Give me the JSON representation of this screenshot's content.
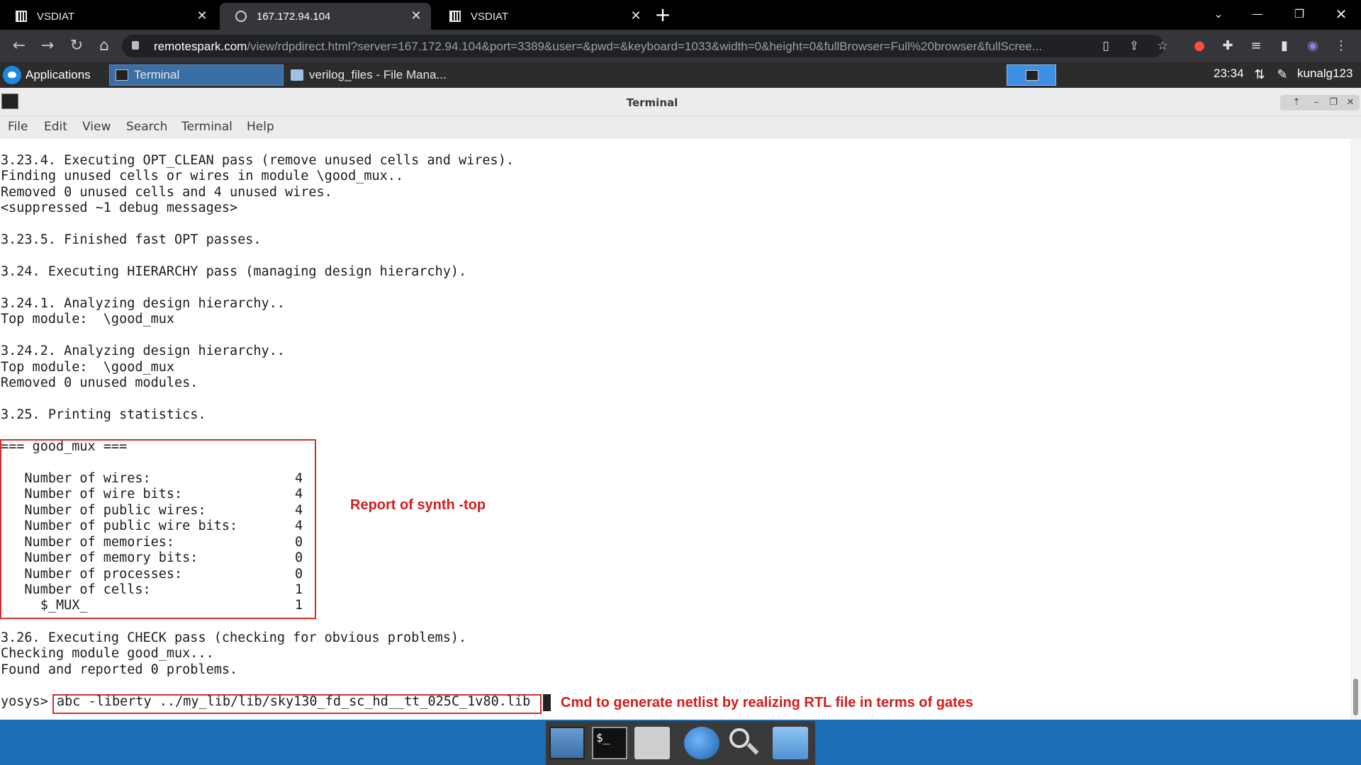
{
  "browser": {
    "tabs": [
      {
        "label": "VSDIAT",
        "icon": "chip-icon",
        "active": false
      },
      {
        "label": "167.172.94.104",
        "icon": "globe-icon",
        "active": true
      },
      {
        "label": "VSDIAT",
        "icon": "chip-icon",
        "active": false
      }
    ],
    "new_tab": "+",
    "url_host": "remotespark.com",
    "url_rest": "/view/rdpdirect.html?server=167.172.94.104&port=3389&user=&pwd=&keyboard=1033&width=0&height=0&fullBrowser=Full%20browser&fullScree..."
  },
  "panel": {
    "applications_label": "Applications",
    "tasks": [
      {
        "label": "Terminal",
        "active": true
      },
      {
        "label": "verilog_files - File Mana...",
        "active": false
      }
    ],
    "clock": "23:34",
    "user": "kunalg123"
  },
  "window": {
    "title": "Terminal",
    "menu": [
      "File",
      "Edit",
      "View",
      "Search",
      "Terminal",
      "Help"
    ]
  },
  "terminal": {
    "lines": [
      "3.23.4. Executing OPT_CLEAN pass (remove unused cells and wires).",
      "Finding unused cells or wires in module \\good_mux..",
      "Removed 0 unused cells and 4 unused wires.",
      "<suppressed ~1 debug messages>",
      "",
      "3.23.5. Finished fast OPT passes.",
      "",
      "3.24. Executing HIERARCHY pass (managing design hierarchy).",
      "",
      "3.24.1. Analyzing design hierarchy..",
      "Top module:  \\good_mux",
      "",
      "3.24.2. Analyzing design hierarchy..",
      "Top module:  \\good_mux",
      "Removed 0 unused modules.",
      "",
      "3.25. Printing statistics.",
      "",
      "=== good_mux ===",
      ""
    ],
    "stats": [
      {
        "label": "   Number of wires:",
        "value": "4"
      },
      {
        "label": "   Number of wire bits:",
        "value": "4"
      },
      {
        "label": "   Number of public wires:",
        "value": "4"
      },
      {
        "label": "   Number of public wire bits:",
        "value": "4"
      },
      {
        "label": "   Number of memories:",
        "value": "0"
      },
      {
        "label": "   Number of memory bits:",
        "value": "0"
      },
      {
        "label": "   Number of processes:",
        "value": "0"
      },
      {
        "label": "   Number of cells:",
        "value": "1"
      },
      {
        "label": "     $_MUX_",
        "value": "1"
      }
    ],
    "after_lines": [
      "",
      "3.26. Executing CHECK pass (checking for obvious problems).",
      "Checking module good_mux...",
      "Found and reported 0 problems.",
      ""
    ],
    "prompt": "yosys>",
    "command": "abc -liberty ../my_lib/lib/sky130_fd_sc_hd__tt_025C_1v80.lib"
  },
  "annotations": {
    "report": "Report of synth -top",
    "cmd": "Cmd to generate netlist by realizing RTL file in terms of gates",
    "color": "#d21c1c"
  }
}
